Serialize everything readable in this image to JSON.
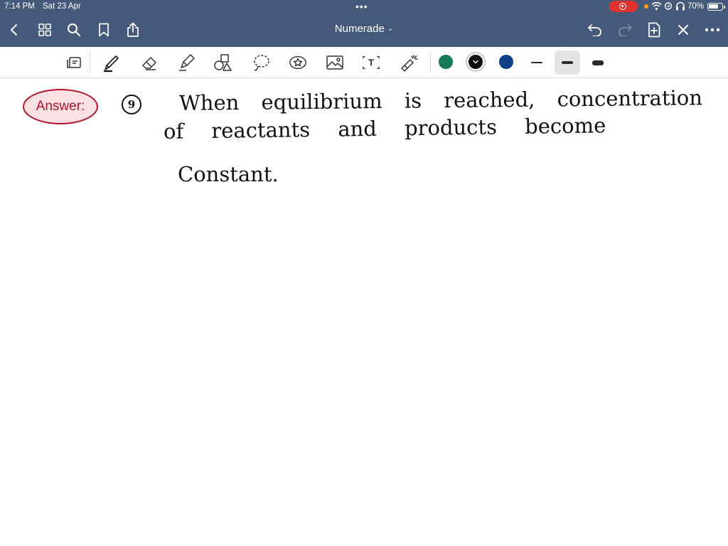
{
  "status_bar": {
    "time": "7:14 PM",
    "date": "Sat 23 Apr",
    "battery_percent": "70%",
    "battery_level": 0.7,
    "icons": [
      "multitasking-dots-icon",
      "screen-recording-icon",
      "privacy-dot-icon",
      "wifi-icon",
      "location-icon",
      "headphones-icon",
      "battery-icon"
    ],
    "record_color": "#e0332d"
  },
  "nav": {
    "title": "Numerade",
    "caret": "⌄",
    "icons": [
      "back-icon",
      "grid-icon",
      "search-icon",
      "bookmark-icon",
      "share-icon",
      "undo-icon",
      "redo-icon",
      "add-page-icon",
      "close-icon",
      "more-icon"
    ]
  },
  "toolbar": {
    "tools": [
      "reading-mode-icon",
      "pen-icon",
      "eraser-icon",
      "highlighter-icon",
      "shapes-icon",
      "lasso-icon",
      "sticker-icon",
      "image-icon",
      "text-box-icon",
      "laser-pointer-icon"
    ],
    "text_tool_glyph": "T",
    "selected_tool": "pen",
    "colors": [
      "#137a55",
      "#0f0f0f",
      "#0d3f8a"
    ],
    "selected_color_index": 1,
    "stroke_widths": [
      "thin",
      "medium",
      "thick"
    ],
    "selected_stroke_index": 1
  },
  "colors": {
    "header_bg": "#455a7a",
    "answer_red": "#b3122a",
    "answer_fill": "#fbe1e3"
  },
  "content": {
    "answer_label": "Answer:",
    "question_number": "9",
    "lines": [
      "When equilibrium is reached, concentration",
      "of reactants and products become",
      "Constant."
    ]
  }
}
